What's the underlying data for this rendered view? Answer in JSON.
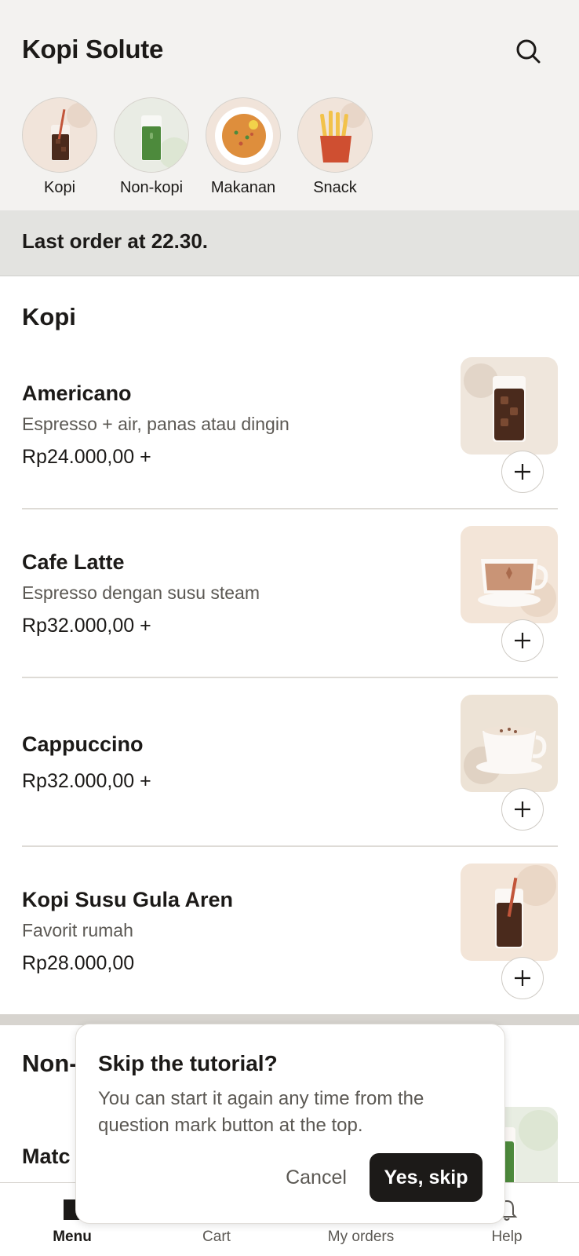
{
  "app": {
    "title": "Kopi Solute"
  },
  "icons": {
    "search": "search-icon",
    "add": "plus-icon",
    "menu": "menu-book-icon",
    "cart": "cart-icon",
    "orders": "orders-icon",
    "help": "bell-icon"
  },
  "categories": [
    {
      "label": "Kopi",
      "icon": "iced-coffee-icon"
    },
    {
      "label": "Non-kopi",
      "icon": "green-drink-icon"
    },
    {
      "label": "Makanan",
      "icon": "food-bowl-icon"
    },
    {
      "label": "Snack",
      "icon": "fries-icon"
    }
  ],
  "notice": "Last order at 22.30.",
  "sections": [
    {
      "title": "Kopi",
      "items": [
        {
          "name": "Americano",
          "desc": "Espresso + air, panas atau dingin",
          "price": "Rp24.000,00 +"
        },
        {
          "name": "Cafe Latte",
          "desc": "Espresso dengan susu steam",
          "price": "Rp32.000,00 +"
        },
        {
          "name": "Cappuccino",
          "desc": "",
          "price": "Rp32.000,00 +"
        },
        {
          "name": "Kopi Susu Gula Aren",
          "desc": "Favorit rumah",
          "price": "Rp28.000,00"
        }
      ]
    },
    {
      "title": "Non-",
      "items": [
        {
          "name": "Matc"
        }
      ]
    }
  ],
  "tabs": [
    {
      "label": "Menu",
      "active": true
    },
    {
      "label": "Cart"
    },
    {
      "label": "My orders"
    },
    {
      "label": "Help"
    }
  ],
  "dialog": {
    "title": "Skip the tutorial?",
    "body": "You can start it again any time from the question mark button at the top.",
    "cancel": "Cancel",
    "confirm": "Yes, skip"
  },
  "colors": {
    "accent": "#1c1a18",
    "header_bg": "#f3f2f0",
    "notice_bg": "#e3e3e0"
  }
}
